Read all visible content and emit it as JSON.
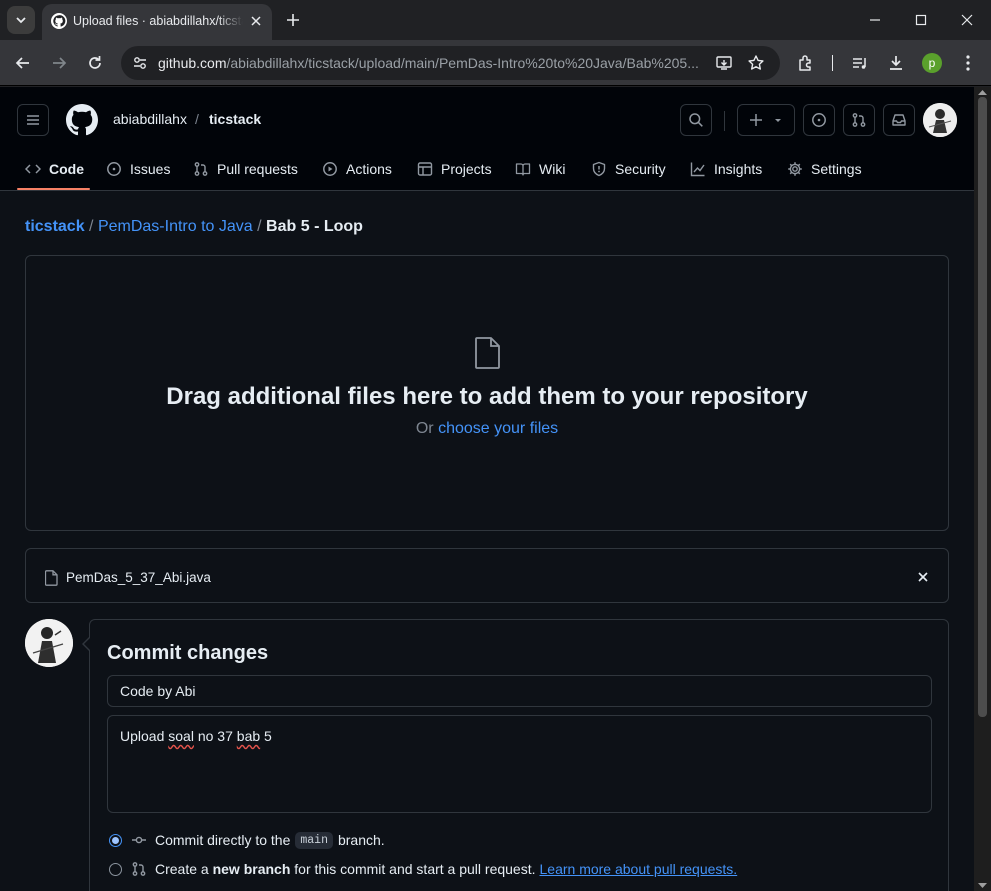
{
  "browser": {
    "tab_title": "Upload files · abiabdillahx/ticstack",
    "url_host": "github.com",
    "url_path": "/abiabdillahx/ticstack/upload/main/PemDas-Intro%20to%20Java/Bab%205...",
    "profile_initial": "p"
  },
  "header": {
    "owner": "abiabdillahx",
    "separator": "/",
    "repo": "ticstack"
  },
  "nav": {
    "code": "Code",
    "issues": "Issues",
    "pulls": "Pull requests",
    "actions": "Actions",
    "projects": "Projects",
    "wiki": "Wiki",
    "security": "Security",
    "insights": "Insights",
    "settings": "Settings"
  },
  "breadcrumb": {
    "repo": "ticstack",
    "folder": "PemDas-Intro to Java",
    "current": "Bab 5 - Loop",
    "sep": "/"
  },
  "dropzone": {
    "title": "Drag additional files here to add them to your repository",
    "or": "Or",
    "choose": "choose your files"
  },
  "file": {
    "name": "PemDas_5_37_Abi.java"
  },
  "commit": {
    "heading": "Commit changes",
    "summary_value": "Code by Abi",
    "desc_word1": "Upload",
    "desc_word2": "soal",
    "desc_word3": "no 37",
    "desc_word4": "bab",
    "desc_word5": "5",
    "option1_pre": "Commit directly to the",
    "option1_branch": "main",
    "option1_post": "branch.",
    "option2_pre": "Create a",
    "option2_bold": "new branch",
    "option2_post": "for this commit and start a pull request.",
    "option2_link": "Learn more about pull requests."
  },
  "colors": {
    "bg": "#0d1117",
    "border": "#30363d",
    "link": "#4493f8",
    "accent_underline": "#f78166"
  }
}
